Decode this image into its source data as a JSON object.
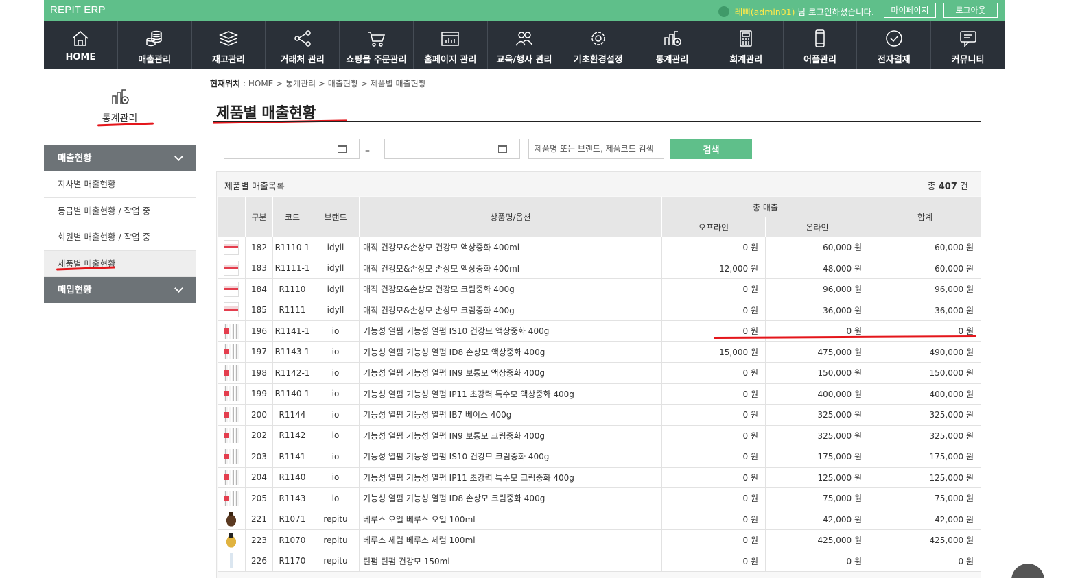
{
  "app": {
    "title": "REPIT ERP"
  },
  "top": {
    "user_name": "레삐(admin01)",
    "user_suffix": "님 로그인하셨습니다.",
    "mypage_label": "마이페이지",
    "logout_label": "로그아웃"
  },
  "nav": [
    {
      "label": "HOME",
      "icon": "home-icon"
    },
    {
      "label": "매출관리",
      "icon": "coins-icon"
    },
    {
      "label": "재고관리",
      "icon": "layers-icon"
    },
    {
      "label": "거래처 관리",
      "icon": "network-icon"
    },
    {
      "label": "쇼핑몰 주문관리",
      "icon": "cart-icon"
    },
    {
      "label": "홈페이지 관리",
      "icon": "browser-icon"
    },
    {
      "label": "교육/행사 관리",
      "icon": "people-icon"
    },
    {
      "label": "기초환경설정",
      "icon": "gear-icon"
    },
    {
      "label": "통계관리",
      "icon": "stats-icon"
    },
    {
      "label": "회계관리",
      "icon": "calculator-icon"
    },
    {
      "label": "어플관리",
      "icon": "mobile-icon"
    },
    {
      "label": "전자결재",
      "icon": "check-circle-icon"
    },
    {
      "label": "커뮤니티",
      "icon": "chat-icon"
    }
  ],
  "sidebar": {
    "title": "통계관리",
    "categories": [
      {
        "label": "매출현황",
        "items": [
          "지사별 매출현황",
          "등급별 매출현황 / 작업 중",
          "회원별 매출현황 / 작업 중",
          "제품별 매출현황"
        ]
      },
      {
        "label": "매입현황",
        "items": []
      }
    ]
  },
  "breadcrumb": {
    "prefix": "현재위치",
    "path": " : HOME > 통계관리 > 매출현황 > 제품별 매출현황"
  },
  "page": {
    "title": "제품별 매출현황"
  },
  "search": {
    "start_date": "",
    "end_date": "",
    "dash": "–",
    "placeholder": "제품명 또는 브랜드, 제품코드 검색",
    "button_label": "검색"
  },
  "list": {
    "title": "제품별 매출목록",
    "total_prefix": "총",
    "total_count": "407",
    "total_suffix": "건",
    "headers": {
      "no": "구분",
      "code": "코드",
      "brand": "브랜드",
      "name": "상품명/옵션",
      "total_sales": "총 매출",
      "offline": "오프라인",
      "online": "온라인",
      "sum": "합계"
    },
    "rows": [
      {
        "thumb": "idyll",
        "no": "182",
        "code": "R1110-1",
        "brand": "idyll",
        "name": "매직 건강모&손상모 건강모 액상중화 400ml",
        "offline": "0 원",
        "online": "60,000 원",
        "sum": "60,000 원"
      },
      {
        "thumb": "idyll",
        "no": "183",
        "code": "R1111-1",
        "brand": "idyll",
        "name": "매직 건강모&손상모 손상모 액상중화 400ml",
        "offline": "12,000 원",
        "online": "48,000 원",
        "sum": "60,000 원"
      },
      {
        "thumb": "idyll",
        "no": "184",
        "code": "R1110",
        "brand": "idyll",
        "name": "매직 건강모&손상모 건강모 크림중화 400g",
        "offline": "0 원",
        "online": "96,000 원",
        "sum": "96,000 원"
      },
      {
        "thumb": "idyll",
        "no": "185",
        "code": "R1111",
        "brand": "idyll",
        "name": "매직 건강모&손상모 손상모 크림중화 400g",
        "offline": "0 원",
        "online": "36,000 원",
        "sum": "36,000 원"
      },
      {
        "thumb": "io",
        "no": "196",
        "code": "R1141-1",
        "brand": "io",
        "name": "기능성 열펌 기능성 열펌 IS10 건강모 액상중화 400g",
        "offline": "0 원",
        "online": "0 원",
        "sum": "0 원"
      },
      {
        "thumb": "io",
        "no": "197",
        "code": "R1143-1",
        "brand": "io",
        "name": "기능성 열펌 기능성 열펌 ID8 손상모 액상중화 400g",
        "offline": "15,000 원",
        "online": "475,000 원",
        "sum": "490,000 원"
      },
      {
        "thumb": "io",
        "no": "198",
        "code": "R1142-1",
        "brand": "io",
        "name": "기능성 열펌 기능성 열펌 IN9 보통모 액상중화 400g",
        "offline": "0 원",
        "online": "150,000 원",
        "sum": "150,000 원"
      },
      {
        "thumb": "io",
        "no": "199",
        "code": "R1140-1",
        "brand": "io",
        "name": "기능성 열펌  기능성 열펌 IP11 초강력 특수모 액상중화 400g",
        "offline": "0 원",
        "online": "400,000 원",
        "sum": "400,000 원"
      },
      {
        "thumb": "io",
        "no": "200",
        "code": "R1144",
        "brand": "io",
        "name": "기능성 열펌  기능성 열펌 IB7 베이스 400g",
        "offline": "0 원",
        "online": "325,000 원",
        "sum": "325,000 원"
      },
      {
        "thumb": "io",
        "no": "202",
        "code": "R1142",
        "brand": "io",
        "name": "기능성 열펌 기능성 열펌 IN9 보통모 크림중화 400g",
        "offline": "0 원",
        "online": "325,000 원",
        "sum": "325,000 원"
      },
      {
        "thumb": "io",
        "no": "203",
        "code": "R1141",
        "brand": "io",
        "name": "기능성 열펌 기능성 열펌 IS10 건강모 크림중화 400g",
        "offline": "0 원",
        "online": "175,000 원",
        "sum": "175,000 원"
      },
      {
        "thumb": "io",
        "no": "204",
        "code": "R1140",
        "brand": "io",
        "name": "기능성 열펌 기능성 열펌 IP11 초강력 특수모 크림중화 400g",
        "offline": "0 원",
        "online": "125,000 원",
        "sum": "125,000 원"
      },
      {
        "thumb": "io",
        "no": "205",
        "code": "R1143",
        "brand": "io",
        "name": "기능성 열펌 기능성 열펌 ID8 손상모 크림중화 400g",
        "offline": "0 원",
        "online": "75,000 원",
        "sum": "75,000 원"
      },
      {
        "thumb": "oil",
        "no": "221",
        "code": "R1071",
        "brand": "repitu",
        "name": "베루스 오일 베루스 오일 100ml",
        "offline": "0 원",
        "online": "42,000 원",
        "sum": "42,000 원"
      },
      {
        "thumb": "serum",
        "no": "223",
        "code": "R1070",
        "brand": "repitu",
        "name": "베루스 세럼 베루스 세럼 100ml",
        "offline": "0 원",
        "online": "425,000 원",
        "sum": "425,000 원"
      },
      {
        "thumb": "tint",
        "no": "226",
        "code": "R1170",
        "brand": "repitu",
        "name": "틴펌  틴펌 건강모 150ml",
        "offline": "0 원",
        "online": "0 원",
        "sum": "0 원"
      }
    ]
  },
  "colors": {
    "brand_green": "#5fbf8a",
    "nav_dark": "#2a3038",
    "annotation_red": "#e4161b"
  }
}
